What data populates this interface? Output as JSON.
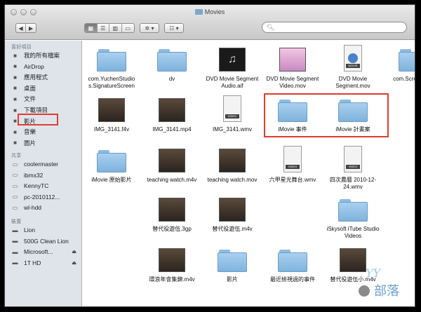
{
  "window": {
    "title": "Movies"
  },
  "toolbar": {
    "nav_back": "◀",
    "nav_forward": "▶",
    "view_icon": "icon-view-icon",
    "view_list": "list-view-icon",
    "view_column": "column-view-icon",
    "view_cover": "coverflow-view-icon",
    "action": "✲ ▾",
    "arrange": "☷ ▾"
  },
  "search": {
    "placeholder": ""
  },
  "sidebar": {
    "favorites_header": "喜好項目",
    "favorites": [
      {
        "label": "我的所有檔案",
        "icon": "all-files-icon"
      },
      {
        "label": "AirDrop",
        "icon": "airdrop-icon"
      },
      {
        "label": "應用程式",
        "icon": "applications-icon"
      },
      {
        "label": "桌面",
        "icon": "desktop-icon"
      },
      {
        "label": "文件",
        "icon": "documents-icon"
      },
      {
        "label": "下載項目",
        "icon": "downloads-icon"
      },
      {
        "label": "影片",
        "icon": "movies-icon"
      },
      {
        "label": "音樂",
        "icon": "music-icon"
      },
      {
        "label": "圖片",
        "icon": "pictures-icon"
      }
    ],
    "shared_header": "共享",
    "shared": [
      {
        "label": "coolermaster",
        "icon": "computer-icon"
      },
      {
        "label": "ibmx32",
        "icon": "computer-icon"
      },
      {
        "label": "KennyTC",
        "icon": "computer-icon"
      },
      {
        "label": "pc-2010112...",
        "icon": "computer-icon"
      },
      {
        "label": "wl-hdd",
        "icon": "computer-icon"
      }
    ],
    "devices_header": "裝置",
    "devices": [
      {
        "label": "Lion",
        "icon": "drive-icon"
      },
      {
        "label": "500G Clean Lion",
        "icon": "drive-icon"
      },
      {
        "label": "Microsoft...",
        "icon": "drive-icon",
        "eject": "⏏"
      },
      {
        "label": "1T HD",
        "icon": "drive-icon",
        "eject": "⏏"
      }
    ]
  },
  "files": [
    {
      "name": "com.YuchenStudio s.SignatureScreen",
      "type": "folder"
    },
    {
      "name": "dv",
      "type": "folder"
    },
    {
      "name": "DVD Movie Segment Audio.aif",
      "type": "audio"
    },
    {
      "name": "DVD Movie Segment Video.mov",
      "type": "movie-thumb"
    },
    {
      "name": "DVD Movie Segment.mov",
      "type": "quicktime"
    },
    {
      "name": "com.Scre td.cha",
      "type": "folder"
    },
    {
      "name": "IMG_3141.f4v",
      "type": "video-thumb"
    },
    {
      "name": "IMG_3141.mp4",
      "type": "video-thumb"
    },
    {
      "name": "IMG_3141.wmv",
      "type": "video-doc"
    },
    {
      "name": "iMovie 事件",
      "type": "folder"
    },
    {
      "name": "iMovie 計畫案",
      "type": "folder"
    },
    {
      "name": "iMovie 原始影片",
      "type": "folder"
    },
    {
      "name": "teaching watch.m4v",
      "type": "video-thumb"
    },
    {
      "name": "teaching watch.mov",
      "type": "video-thumb"
    },
    {
      "name": "六甲星光舞台.wmv",
      "type": "video-doc"
    },
    {
      "name": "四次農曆 2010-12-24.wmv",
      "type": "video-doc"
    },
    {
      "name": "替代役遊伍.3gp",
      "type": "video-thumb"
    },
    {
      "name": "替代役遊伍.m4v",
      "type": "video-thumb"
    },
    {
      "name": "iSkysoft iTube Studio Videos",
      "type": "folder"
    },
    {
      "name": "環浪年會集錦.m4v",
      "type": "video-thumb"
    },
    {
      "name": "影片",
      "type": "folder"
    },
    {
      "name": "最近檢視過的事件",
      "type": "folder"
    },
    {
      "name": "替代役遊伍小.m4v",
      "type": "video-thumb"
    }
  ],
  "colors": {
    "highlight": "#e23b2f",
    "folder": "#8fbde3",
    "sidebar_bg": "#dfe4ea"
  },
  "watermark": {
    "text": "部落",
    "logo": "apple-logo-icon"
  }
}
